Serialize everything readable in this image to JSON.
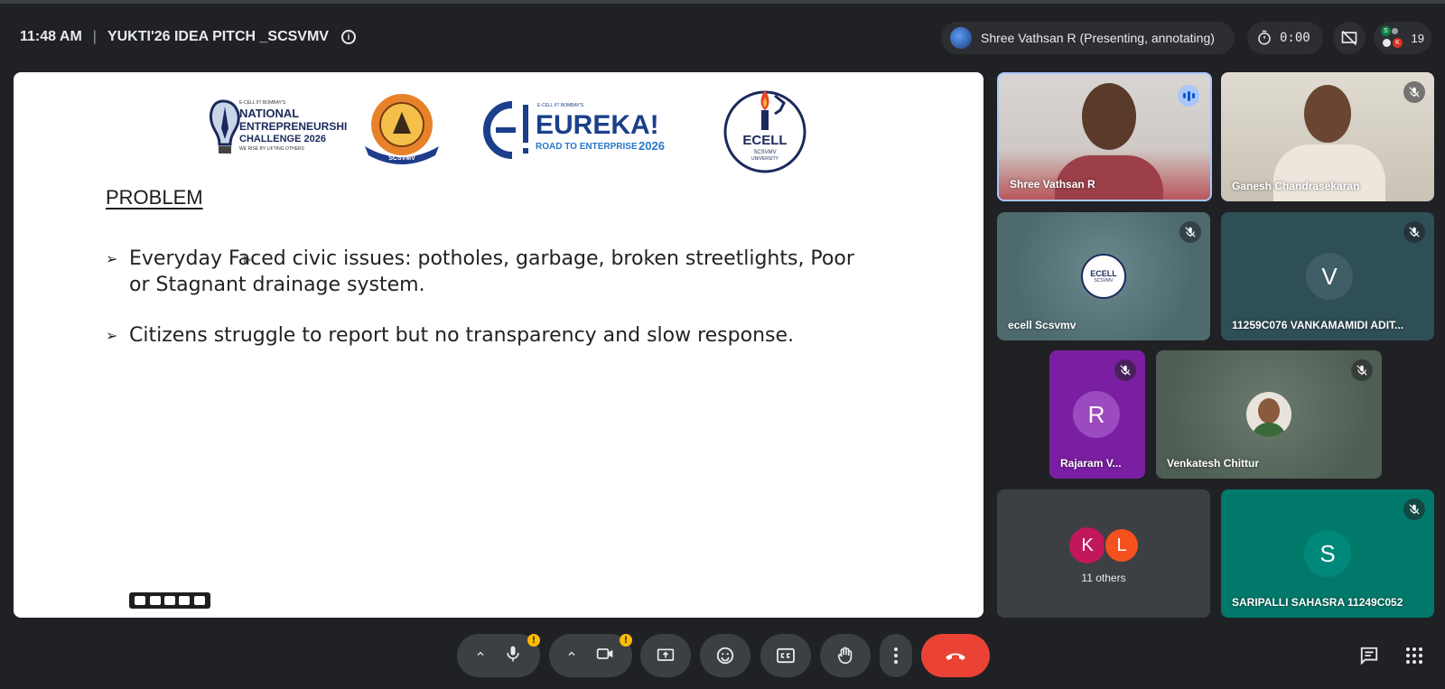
{
  "meeting": {
    "time": "11:48 AM",
    "title": "YUKTI'26 IDEA PITCH _SCSVMV",
    "info_icon": "info-icon"
  },
  "header": {
    "presenter_chip": "Shree Vathsan R (Presenting, annotating)",
    "timer": "0:00",
    "participant_count": "19",
    "mini_avatars": [
      "S",
      "K"
    ]
  },
  "slide": {
    "logos": {
      "nec_small": "E-CELL IIT BOMBAY'S",
      "nec_line1": "NATIONAL",
      "nec_line2": "ENTREPRENEURSHIP",
      "nec_line3": "CHALLENGE 2026",
      "nec_tagline": "WE RISE BY LIFTING OTHERS",
      "scsvmv_label": "SCSVMV",
      "eureka_small": "E-CELL IIT BOMBAY'S",
      "eureka_title": "EUREKA!",
      "eureka_sub": "ROAD TO ENTERPRISE",
      "eureka_year": "2026",
      "ecell_title": "ECELL",
      "ecell_line1": "SCSVMV",
      "ecell_line2": "UNIVERSITY"
    },
    "heading": "PROBLEM",
    "bullets": [
      "Everyday Faced civic issues: potholes, garbage, broken streetlights, Poor or Stagnant drainage system.",
      "Citizens struggle to report but no transparency and slow response."
    ]
  },
  "participants": [
    {
      "name": "Shree Vathsan R",
      "state": "speaking"
    },
    {
      "name": "Ganesh Chandrasekaran",
      "state": "muted"
    },
    {
      "name": "ecell Scsvmv",
      "state": "muted",
      "avatar": "ECELL",
      "avatar_sub": "SCSVMV"
    },
    {
      "name": "11259C076 VANKAMAMIDI ADIT...",
      "state": "muted",
      "initial": "V"
    },
    {
      "name": "Rajaram V...",
      "state": "muted",
      "initial": "R"
    },
    {
      "name": "Venkatesh Chittur",
      "state": "muted"
    },
    {
      "name": "11 others",
      "initials": [
        "K",
        "L"
      ]
    },
    {
      "name": "SARIPALLI SAHASRA 11249C052",
      "state": "muted",
      "initial": "S"
    }
  ],
  "colors": {
    "background": "#202124",
    "control": "#3c4043",
    "end_call": "#ea4335",
    "speaking": "#a8c7fa",
    "warning": "#fbbc04"
  },
  "controls": {
    "mic_warning": "!",
    "camera_warning": "!"
  }
}
